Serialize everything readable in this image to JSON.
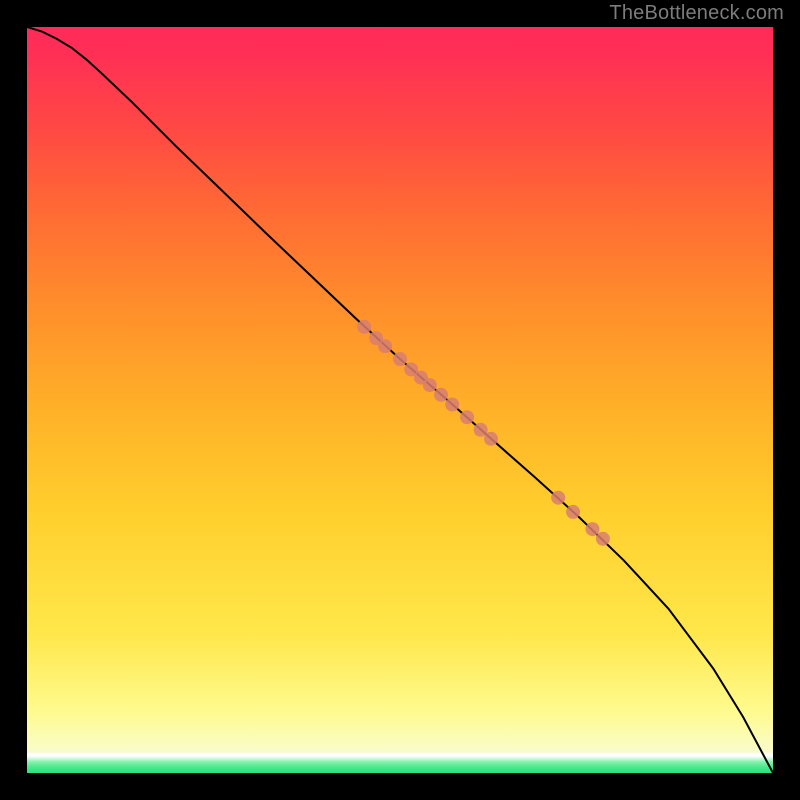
{
  "watermark": "TheBottleneck.com",
  "chart_data": {
    "type": "line",
    "title": "",
    "xlabel": "",
    "ylabel": "",
    "xlim": [
      0,
      1
    ],
    "ylim": [
      0,
      1
    ],
    "grid": false,
    "legend": false,
    "curve": [
      {
        "x": 0.0,
        "y": 1.0
      },
      {
        "x": 0.02,
        "y": 0.994
      },
      {
        "x": 0.04,
        "y": 0.984
      },
      {
        "x": 0.06,
        "y": 0.972
      },
      {
        "x": 0.08,
        "y": 0.956
      },
      {
        "x": 0.1,
        "y": 0.938
      },
      {
        "x": 0.14,
        "y": 0.9
      },
      {
        "x": 0.2,
        "y": 0.84
      },
      {
        "x": 0.26,
        "y": 0.782
      },
      {
        "x": 0.32,
        "y": 0.724
      },
      {
        "x": 0.38,
        "y": 0.667
      },
      {
        "x": 0.44,
        "y": 0.61
      },
      {
        "x": 0.5,
        "y": 0.555
      },
      {
        "x": 0.56,
        "y": 0.503
      },
      {
        "x": 0.62,
        "y": 0.45
      },
      {
        "x": 0.68,
        "y": 0.397
      },
      {
        "x": 0.74,
        "y": 0.343
      },
      {
        "x": 0.8,
        "y": 0.285
      },
      {
        "x": 0.86,
        "y": 0.22
      },
      {
        "x": 0.92,
        "y": 0.14
      },
      {
        "x": 0.96,
        "y": 0.075
      },
      {
        "x": 1.0,
        "y": 0.0
      }
    ],
    "series": [
      {
        "name": "markers",
        "type": "scatter",
        "color": "#d87e70",
        "points": [
          {
            "x": 0.452,
            "y": 0.598
          },
          {
            "x": 0.468,
            "y": 0.583
          },
          {
            "x": 0.48,
            "y": 0.572
          },
          {
            "x": 0.5,
            "y": 0.555
          },
          {
            "x": 0.515,
            "y": 0.541
          },
          {
            "x": 0.528,
            "y": 0.53
          },
          {
            "x": 0.54,
            "y": 0.52
          },
          {
            "x": 0.555,
            "y": 0.507
          },
          {
            "x": 0.57,
            "y": 0.494
          },
          {
            "x": 0.59,
            "y": 0.477
          },
          {
            "x": 0.608,
            "y": 0.46
          },
          {
            "x": 0.622,
            "y": 0.448
          },
          {
            "x": 0.712,
            "y": 0.369
          },
          {
            "x": 0.732,
            "y": 0.35
          },
          {
            "x": 0.758,
            "y": 0.327
          },
          {
            "x": 0.772,
            "y": 0.314
          }
        ]
      }
    ]
  },
  "colors": {
    "marker": "#d87e70",
    "curve": "#000000"
  }
}
